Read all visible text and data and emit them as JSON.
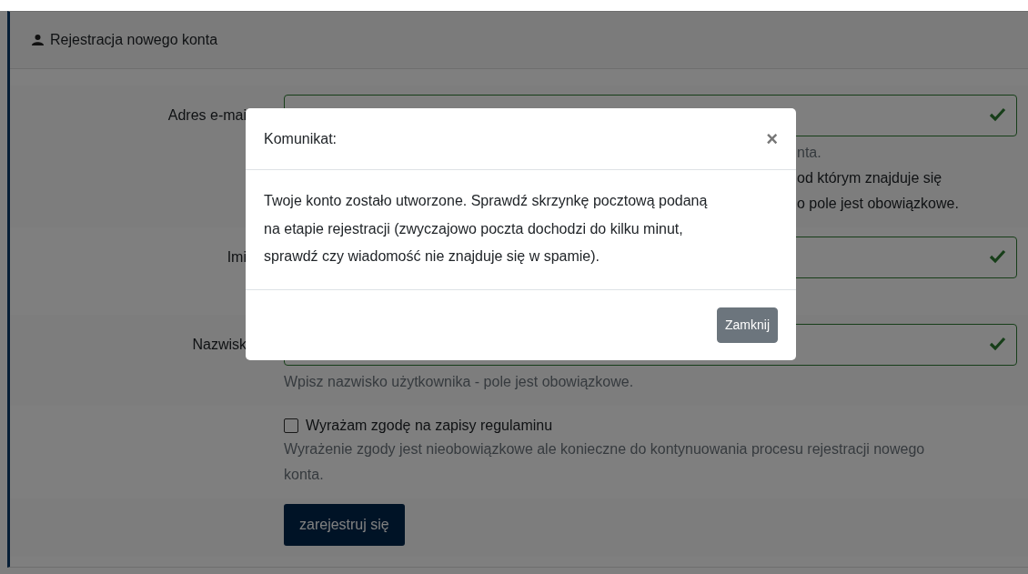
{
  "card": {
    "title": "Rejestracja nowego konta"
  },
  "fields": [
    {
      "label": "Adres e-mai",
      "valid": true,
      "help": {
        "clipped": true,
        "lines": [
          "nta.",
          "od którym znajduje się",
          "o pole jest obowiązkowe."
        ]
      }
    },
    {
      "label": "Imi",
      "valid": true
    },
    {
      "label": "Nazwisk",
      "valid": true,
      "help": {
        "clipped": false,
        "lines": [
          "Wpisz nazwisko użytkownika - pole jest obowiązkowe."
        ]
      }
    }
  ],
  "consent": {
    "label": "Wyrażam zgodę na zapisy regulaminu",
    "checked": false,
    "help": "Wyrażenie zgody jest nieobowiązkowe ale konieczne do kontynuowania procesu rejestracji nowego konta."
  },
  "submit": "zarejestruj się",
  "modal": {
    "title": "Komunikat:",
    "close": "×",
    "message": "Twoje konto zostało utworzone. Sprawdź skrzynkę pocztową podaną na etapie rejestracji (zwyczajowo poczta dochodzi do kilku minut, sprawdź czy wiadomość nie znajduje się w spamie).",
    "button": "Zamknij"
  }
}
